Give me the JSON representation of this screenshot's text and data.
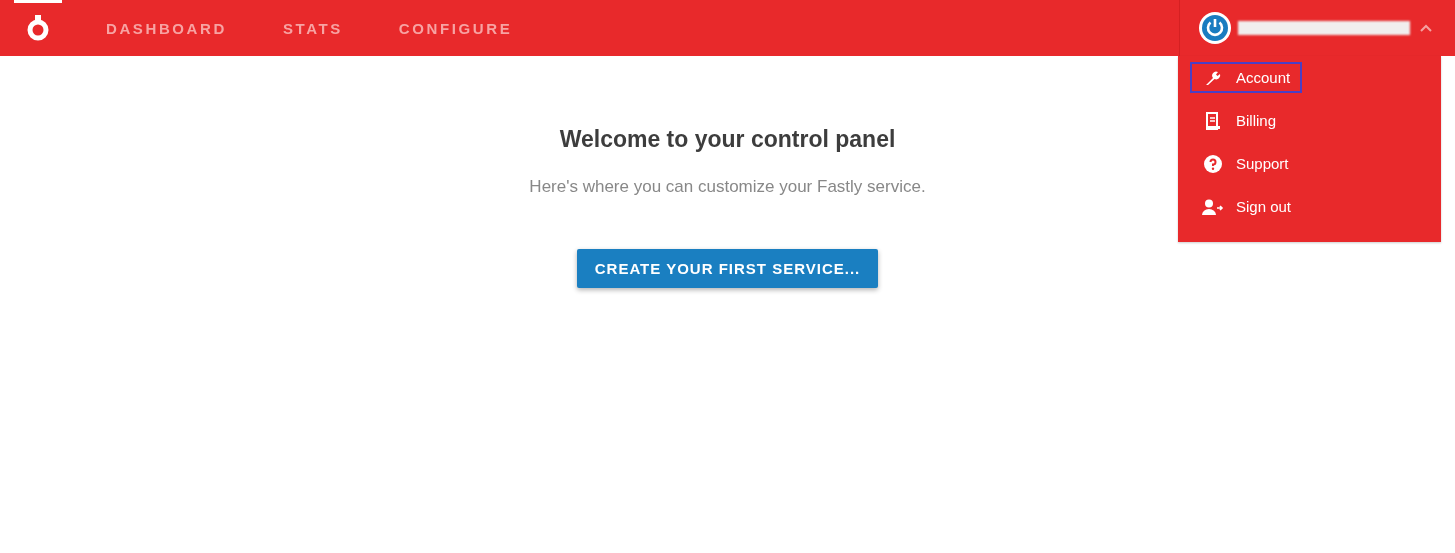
{
  "nav": {
    "items": [
      {
        "label": "DASHBOARD",
        "selected": false
      },
      {
        "label": "STATS",
        "selected": false
      },
      {
        "label": "CONFIGURE",
        "selected": false
      }
    ]
  },
  "user_menu": {
    "expanded": true,
    "items": [
      {
        "kind": "wrench",
        "label": "Account",
        "selected": true
      },
      {
        "kind": "receipt",
        "label": "Billing",
        "selected": false
      },
      {
        "kind": "help",
        "label": "Support",
        "selected": false
      },
      {
        "kind": "signout",
        "label": "Sign out",
        "selected": false
      }
    ]
  },
  "main": {
    "title": "Welcome to your control panel",
    "subtitle": "Here's where you can customize your Fastly service.",
    "button": "CREATE YOUR FIRST SERVICE..."
  }
}
